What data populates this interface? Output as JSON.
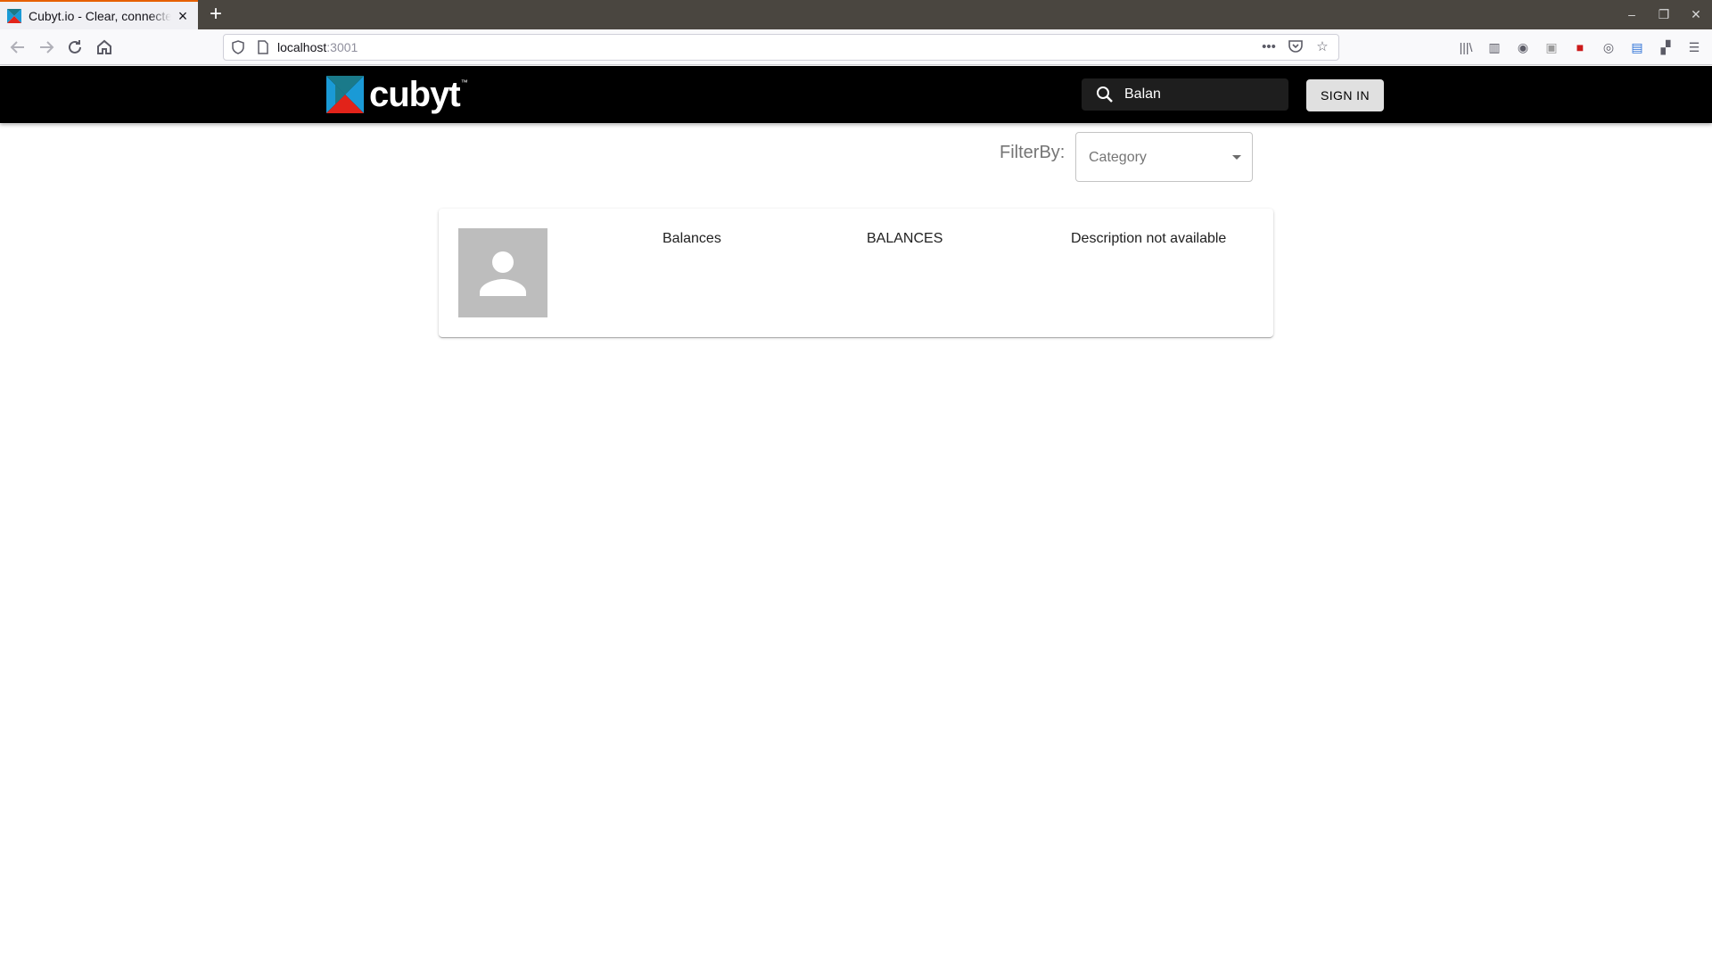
{
  "browser": {
    "tab_title": "Cubyt.io - Clear, connected",
    "url_host": "localhost",
    "url_port": ":3001",
    "icons": [
      "back-icon",
      "forward-icon",
      "reload-icon",
      "home-icon",
      "shield-icon",
      "page-icon",
      "more-icon",
      "pocket-icon",
      "bookmark-star-icon",
      "library-icon",
      "sidebar-icon",
      "account-icon",
      "extension-icon",
      "menu-icon"
    ]
  },
  "header": {
    "logo_text": "cubyt",
    "logo_tm": "™",
    "search_value": "Balan",
    "signin_label": "SIGN IN"
  },
  "filter": {
    "label": "FilterBy:",
    "placeholder": "Category"
  },
  "results": [
    {
      "name": "Balances",
      "code": "BALANCES",
      "description": "Description not available"
    }
  ],
  "colors": {
    "appbar": "#000000",
    "logo_blue": "#1a9ad6",
    "logo_red": "#e2231a",
    "logo_teal": "#1a7a8a"
  }
}
